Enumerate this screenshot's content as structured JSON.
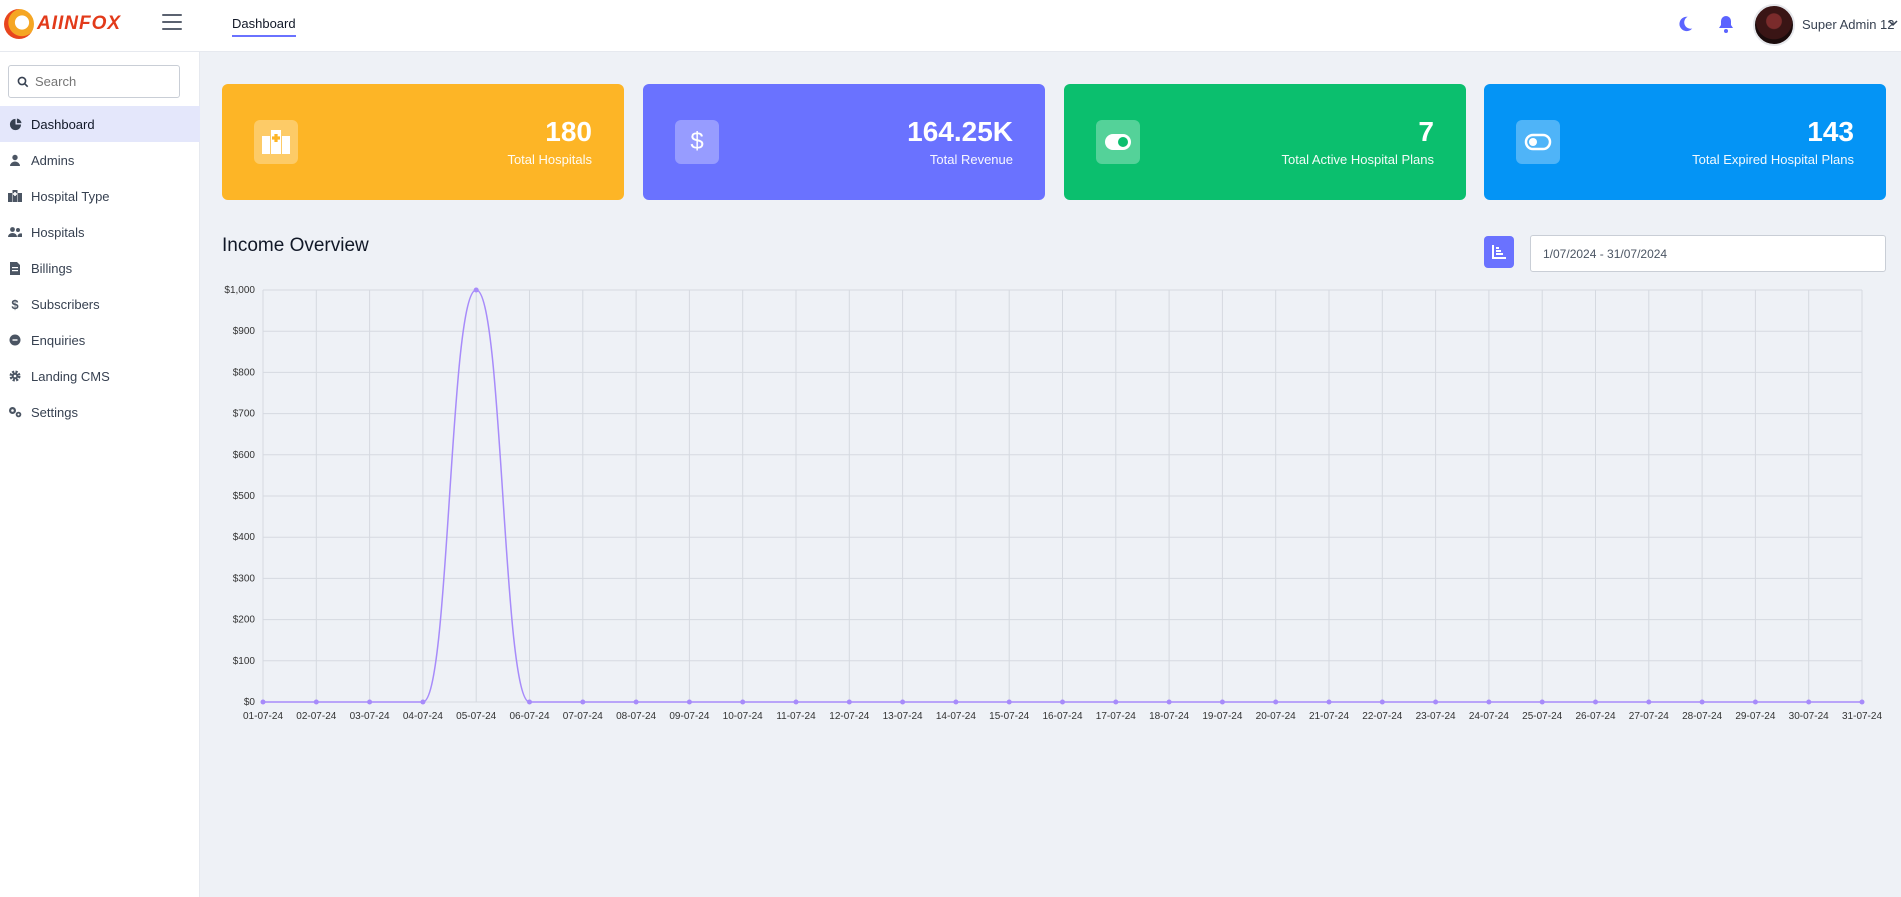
{
  "brand": {
    "logo_text": "AIINFOX"
  },
  "header": {
    "active_tab": "Dashboard",
    "user_name": "Super Admin 12"
  },
  "sidebar": {
    "search_placeholder": "Search",
    "items": [
      {
        "label": "Dashboard",
        "icon": "pie-chart-icon",
        "active": true
      },
      {
        "label": "Admins",
        "icon": "user-icon"
      },
      {
        "label": "Hospital Type",
        "icon": "hospital-icon"
      },
      {
        "label": "Hospitals",
        "icon": "users-icon"
      },
      {
        "label": "Billings",
        "icon": "invoice-icon"
      },
      {
        "label": "Subscribers",
        "icon": "dollar-icon"
      },
      {
        "label": "Enquiries",
        "icon": "circle-icon"
      },
      {
        "label": "Landing CMS",
        "icon": "gear-icon"
      },
      {
        "label": "Settings",
        "icon": "gears-icon"
      }
    ]
  },
  "cards": [
    {
      "value": "180",
      "label": "Total Hospitals",
      "color": "#fdb526",
      "icon": "hospital-icon"
    },
    {
      "value": "164.25K",
      "label": "Total Revenue",
      "color": "#6a72ff",
      "icon": "dollar-icon"
    },
    {
      "value": "7",
      "label": "Total Active Hospital Plans",
      "color": "#0bbf6e",
      "icon": "toggle-on-icon"
    },
    {
      "value": "143",
      "label": "Total Expired Hospital Plans",
      "color": "#0494f5",
      "icon": "toggle-off-icon"
    }
  ],
  "income": {
    "title": "Income Overview",
    "date_range": "1/07/2024 - 31/07/2024"
  },
  "chart_data": {
    "type": "line",
    "series": [
      {
        "color": "#a78bfa",
        "values": [
          0,
          0,
          0,
          0,
          1000,
          0,
          0,
          0,
          0,
          0,
          0,
          0,
          0,
          0,
          0,
          0,
          0,
          0,
          0,
          0,
          0,
          0,
          0,
          0,
          0,
          0,
          0,
          0,
          0,
          0,
          0
        ]
      }
    ],
    "categories": [
      "01-07-24",
      "02-07-24",
      "03-07-24",
      "04-07-24",
      "05-07-24",
      "06-07-24",
      "07-07-24",
      "08-07-24",
      "09-07-24",
      "10-07-24",
      "11-07-24",
      "12-07-24",
      "13-07-24",
      "14-07-24",
      "15-07-24",
      "16-07-24",
      "17-07-24",
      "18-07-24",
      "19-07-24",
      "20-07-24",
      "21-07-24",
      "22-07-24",
      "23-07-24",
      "24-07-24",
      "25-07-24",
      "26-07-24",
      "27-07-24",
      "28-07-24",
      "29-07-24",
      "30-07-24",
      "31-07-24"
    ],
    "y_ticks": [
      "$0",
      "$100",
      "$200",
      "$300",
      "$400",
      "$500",
      "$600",
      "$700",
      "$800",
      "$900",
      "$1,000"
    ],
    "ylim": [
      0,
      1000
    ],
    "grid": true
  }
}
